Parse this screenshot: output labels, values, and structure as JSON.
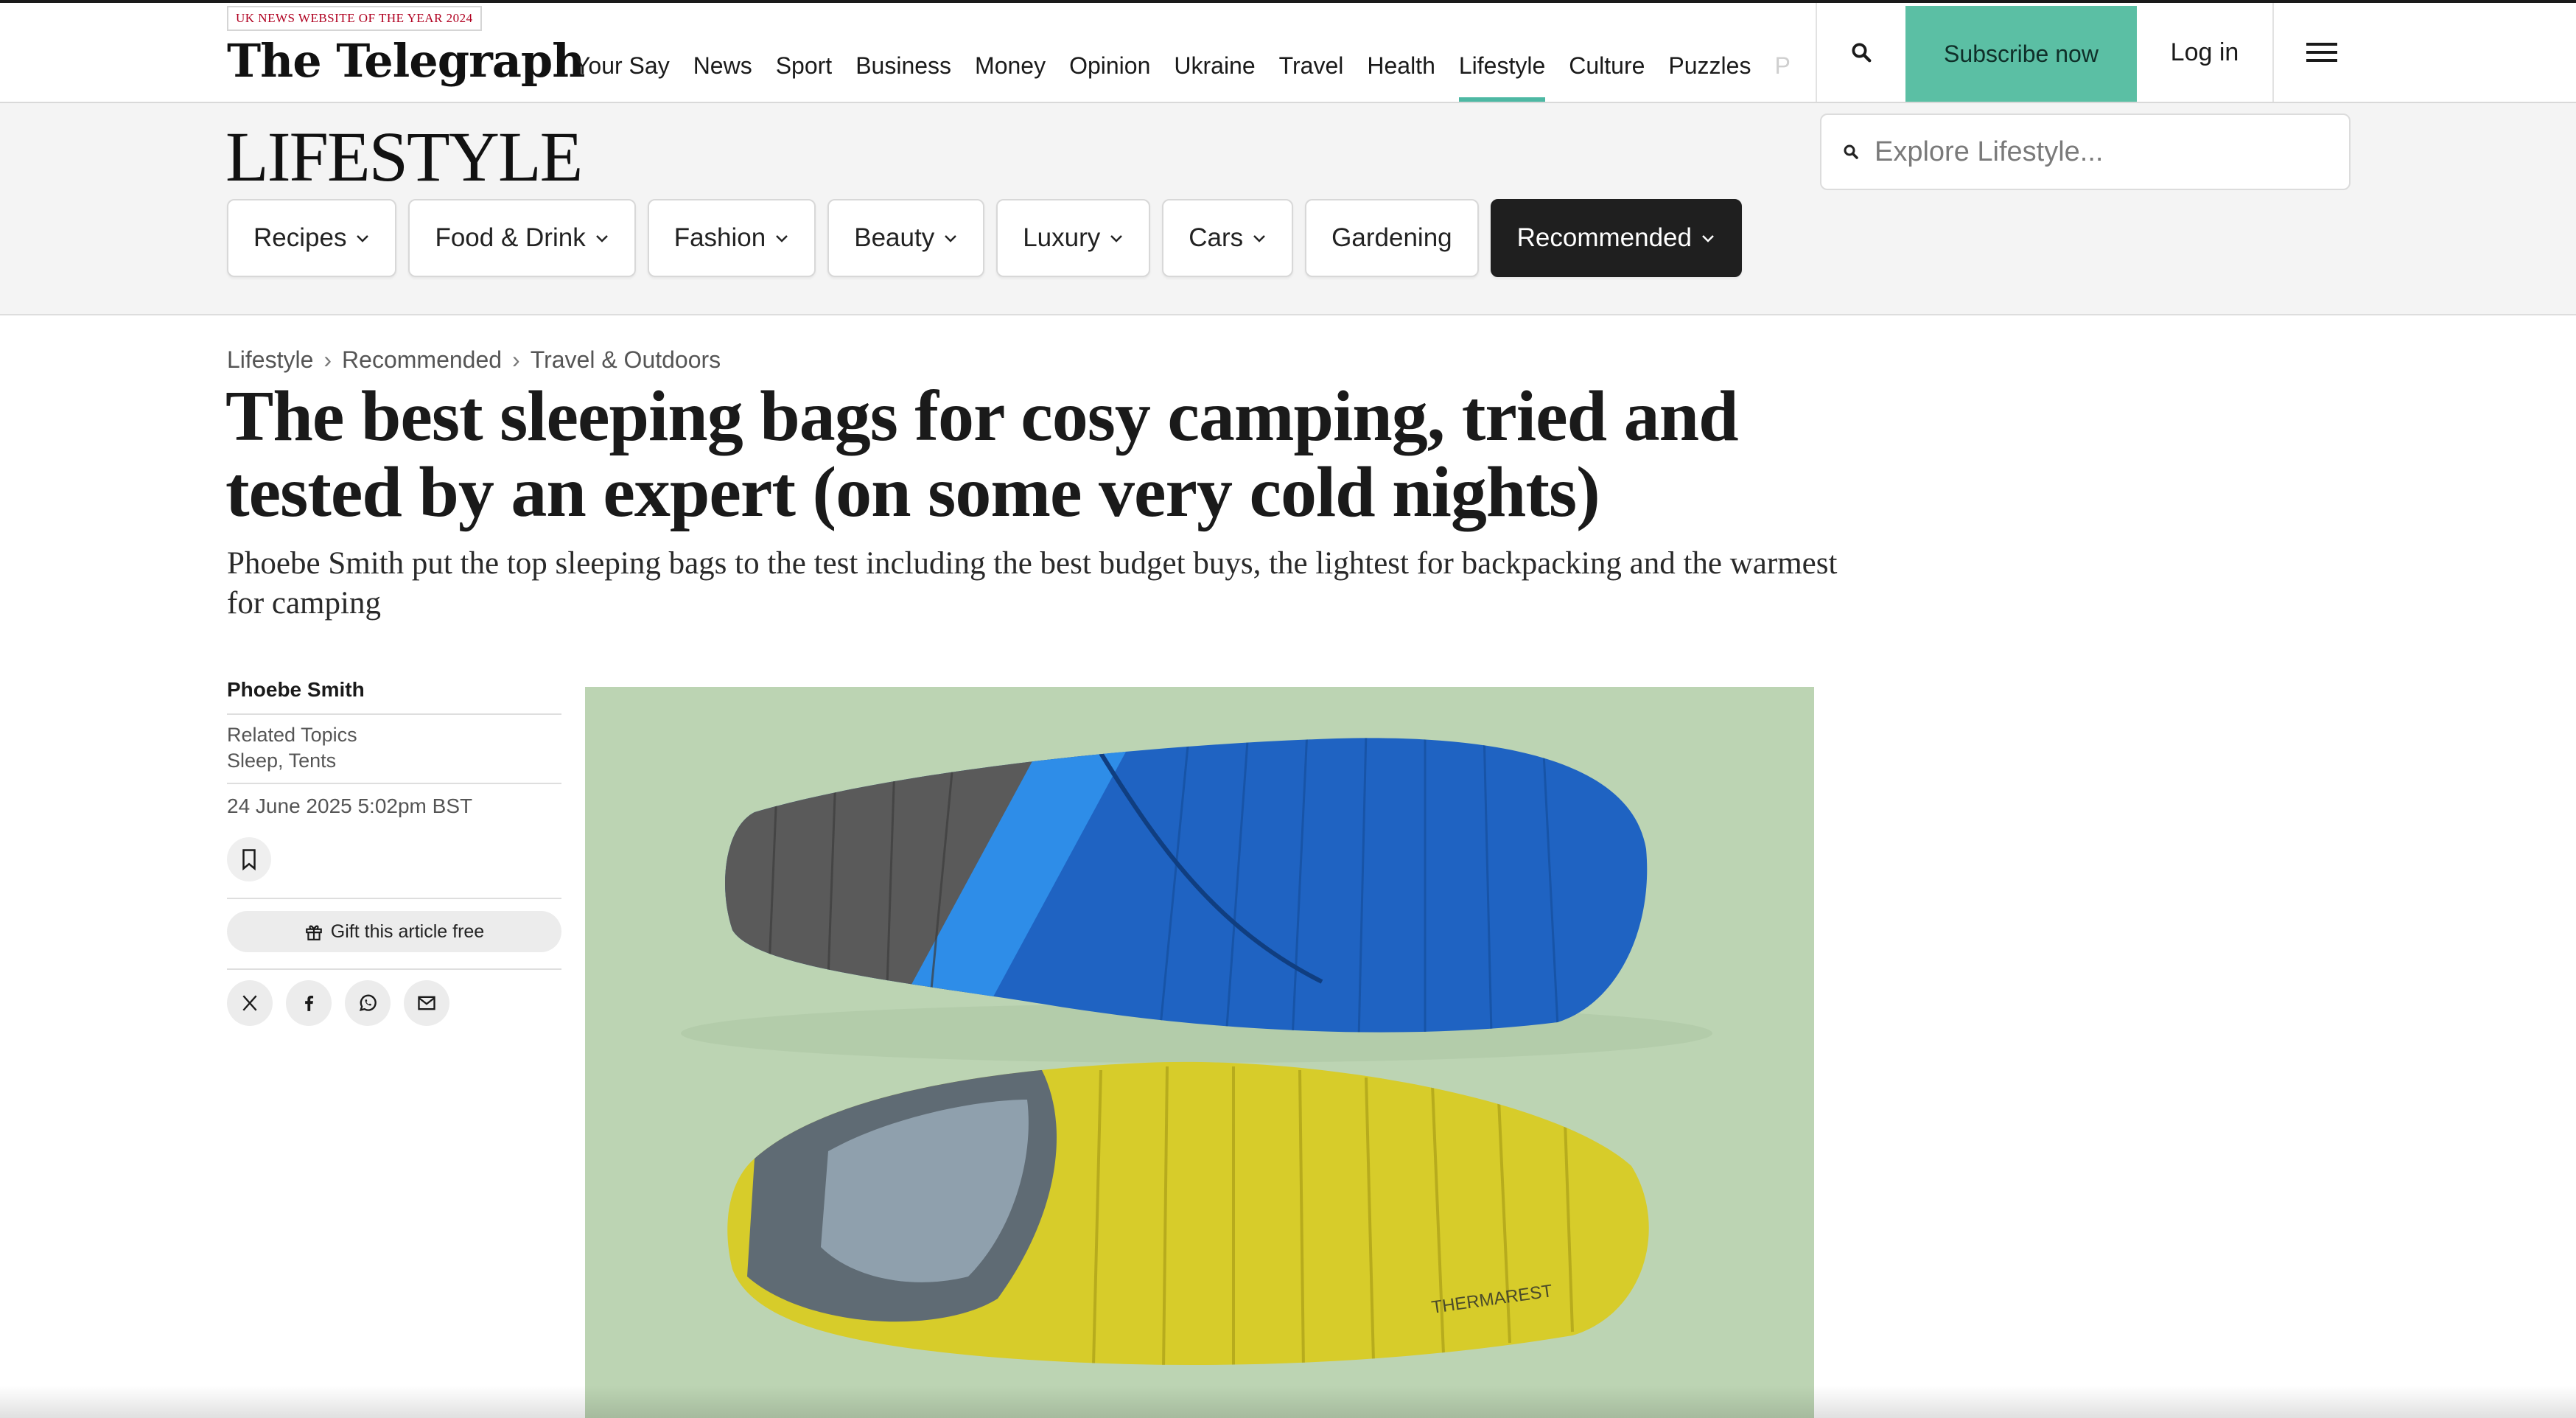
{
  "masthead": {
    "award": "UK NEWS WEBSITE OF THE YEAR 2024",
    "logo": "The Telegraph",
    "nav": [
      "Your Say",
      "News",
      "Sport",
      "Business",
      "Money",
      "Opinion",
      "Ukraine",
      "Travel",
      "Health",
      "Lifestyle",
      "Culture",
      "Puzzles",
      "P"
    ],
    "active_nav": "Lifestyle",
    "subscribe_label": "Subscribe now",
    "login_label": "Log in",
    "accent_color": "#5bbfa4"
  },
  "section": {
    "title": "LIFESTYLE",
    "search_placeholder": "Explore Lifestyle...",
    "pills": [
      {
        "label": "Recipes",
        "dropdown": true
      },
      {
        "label": "Food & Drink",
        "dropdown": true
      },
      {
        "label": "Fashion",
        "dropdown": true
      },
      {
        "label": "Beauty",
        "dropdown": true
      },
      {
        "label": "Luxury",
        "dropdown": true
      },
      {
        "label": "Cars",
        "dropdown": true
      },
      {
        "label": "Gardening",
        "dropdown": false
      },
      {
        "label": "Recommended",
        "dropdown": true,
        "selected": true
      }
    ]
  },
  "article": {
    "breadcrumb": [
      "Lifestyle",
      "Recommended",
      "Travel & Outdoors"
    ],
    "headline": "The best sleeping bags for cosy camping, tried and tested by an expert (on some very cold nights)",
    "standfirst": "Phoebe Smith put the top sleeping bags to the test including the best budget buys, the lightest for backpacking and the warmest for camping",
    "author": "Phoebe Smith",
    "related_label": "Related Topics",
    "related_topics": "Sleep, Tents",
    "date": "24 June 2025 5:02pm BST",
    "gift_label": "Gift this article free",
    "share_icons": [
      "x-icon",
      "facebook-icon",
      "whatsapp-icon",
      "email-icon"
    ],
    "hero_brand_text": "THERMAREST"
  }
}
